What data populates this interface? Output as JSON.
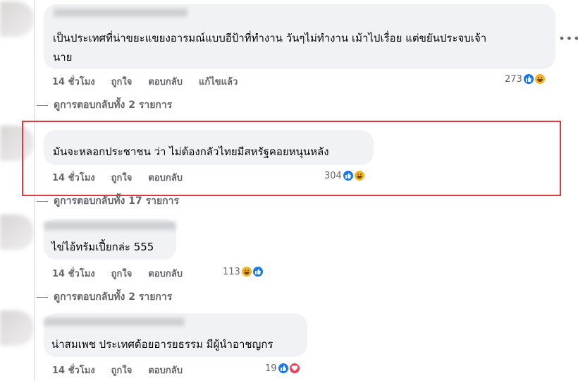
{
  "comments": [
    {
      "text": "เป็นประเทศที่น่าขยะแขยงอารมณ์แบบอีป้าที่ทำงาน วันๆไม่ทำงาน เม้าไปเรื่อย แต่ขยันประจบเจ้านาย",
      "line1": "เป็นประเทศที่น่าขยะแขยงอารมณ์แบบอีป้าที่ทำงาน วันๆไม่ทำงาน เม้าไปเรื่อย แต่ขยันประจบเจ้า",
      "line2": "นาย",
      "time": "14 ชั่วโมง",
      "like": "ถูกใจ",
      "reply": "ตอบกลับ",
      "edited": "แก้ไขแล้ว",
      "reactions": {
        "count": "273",
        "icons": [
          "like-icon",
          "haha-icon"
        ]
      },
      "view_replies": "ดูการตอบกลับทั้ง 2 รายการ"
    },
    {
      "text": "มันจะหลอกประชาชน ว่า ไม่ต้องกลัวไทยมีสหรัฐคอยหนุนหลัง",
      "time": "14 ชั่วโมง",
      "like": "ถูกใจ",
      "reply": "ตอบกลับ",
      "reactions": {
        "count": "304",
        "icons": [
          "like-icon",
          "haha-icon"
        ]
      },
      "view_replies": "ดูการตอบกลับทั้ง 17 รายการ"
    },
    {
      "text": "ไข่ไอ้ทรัมเปี้ยกล่ะ 555",
      "time": "14 ชั่วโมง",
      "like": "ถูกใจ",
      "reply": "ตอบกลับ",
      "reactions": {
        "count": "113",
        "icons": [
          "haha-icon",
          "like-icon"
        ]
      },
      "view_replies": "ดูการตอบกลับทั้ง 2 รายการ"
    },
    {
      "text": "น่าสมเพช ประเทศด้อยอารยธรรม มีผู้นำอาชญกร",
      "time": "14 ชั่วโมง",
      "like": "ถูกใจ",
      "reply": "ตอบกลับ",
      "reactions": {
        "count": "19",
        "icons": [
          "like-icon",
          "love-icon"
        ]
      }
    }
  ],
  "colors": {
    "highlight": "#e0373a",
    "bubble": "#f0f2f5",
    "meta": "#65676b",
    "like": "#1877f2",
    "haha": "#f7b125",
    "love": "#f33e58"
  }
}
